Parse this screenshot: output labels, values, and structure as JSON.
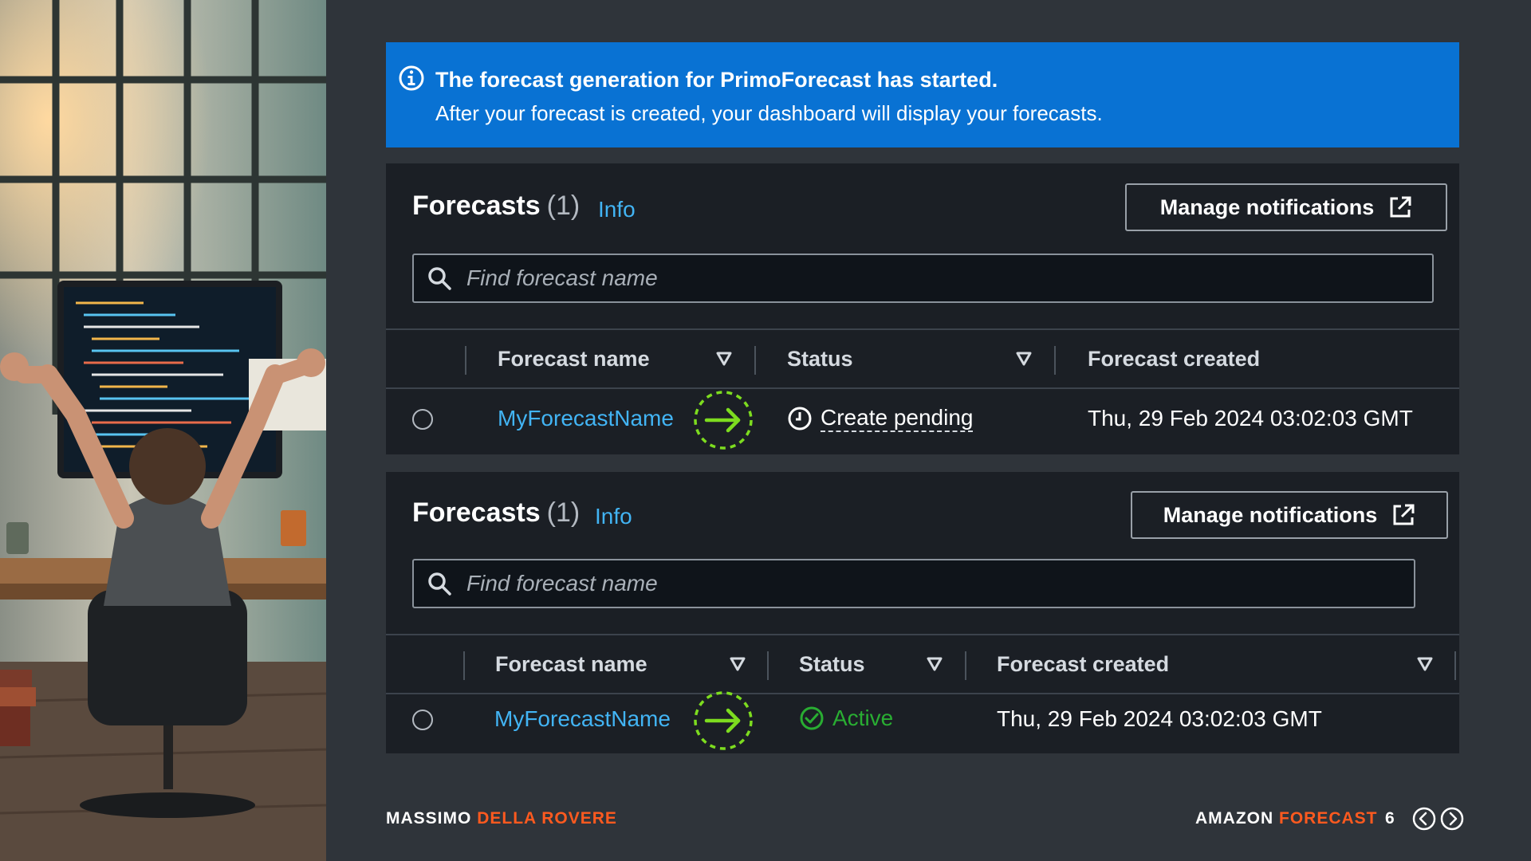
{
  "banner": {
    "title": "The forecast generation for PrimoForecast has started.",
    "text": "After your forecast is created, your dashboard will display your forecasts.",
    "icon": "info-circle-icon",
    "color": "#0972d3"
  },
  "panels": [
    {
      "title": "Forecasts",
      "count": "(1)",
      "info_label": "Info",
      "manage_label": "Manage notifications",
      "search_placeholder": "Find forecast name",
      "columns": [
        "Forecast name",
        "Status",
        "Forecast created"
      ],
      "row": {
        "name": "MyForecastName",
        "status": "Create pending",
        "status_icon": "clock-icon",
        "created": "Thu, 29 Feb 2024 03:02:03 GMT"
      }
    },
    {
      "title": "Forecasts",
      "count": "(1)",
      "info_label": "Info",
      "manage_label": "Manage notifications",
      "search_placeholder": "Find forecast name",
      "columns": [
        "Forecast name",
        "Status",
        "Forecast created"
      ],
      "row": {
        "name": "MyForecastName",
        "status": "Active",
        "status_icon": "check-circle-icon",
        "created": "Thu, 29 Feb 2024 03:02:03 GMT"
      }
    }
  ],
  "footer": {
    "author_first": "MASSIMO",
    "author_last": "DELLA ROVERE",
    "product_first": "AMAZON",
    "product_last": "FORECAST",
    "page": "6"
  },
  "colors": {
    "link": "#42b4f4",
    "active": "#29ad32",
    "accent": "#ff5a1f",
    "arrow": "#7ddc1f"
  }
}
